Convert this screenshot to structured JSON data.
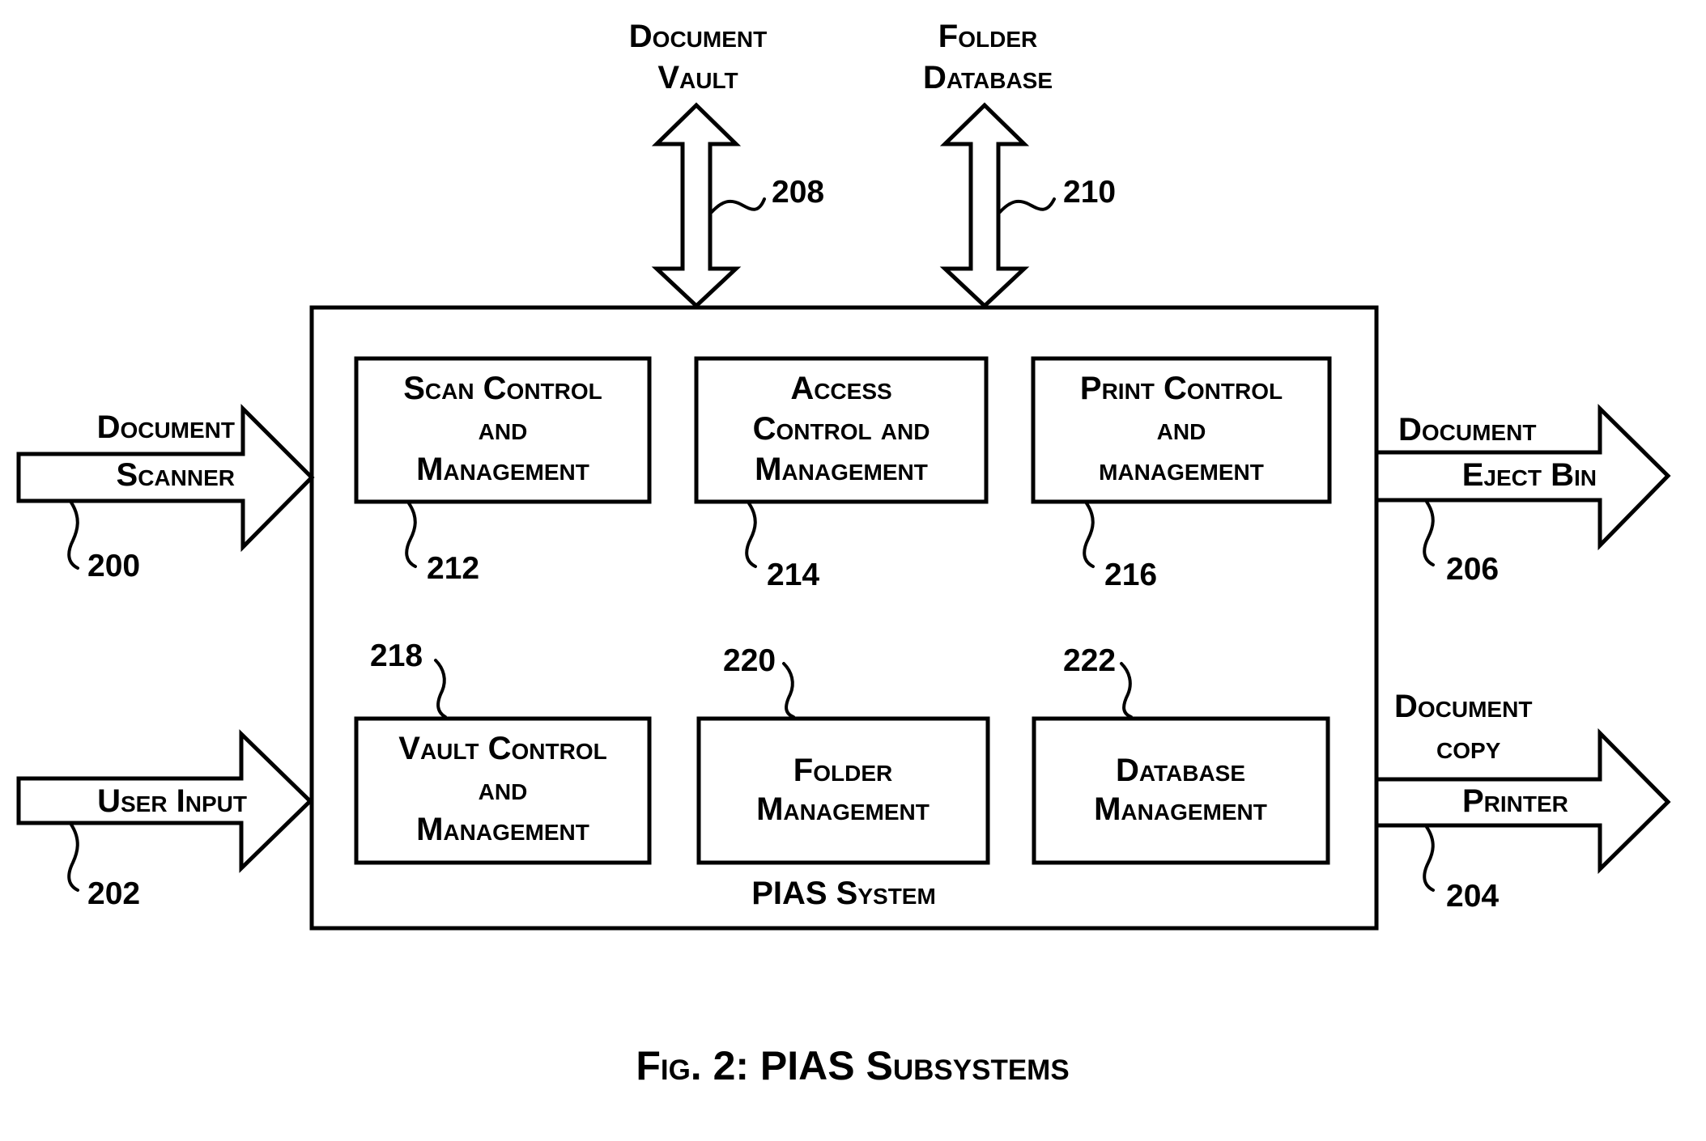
{
  "figure": {
    "caption": "Fig. 2: PIAS Subsystems",
    "system_label": "PIAS System"
  },
  "external": {
    "document_vault": {
      "lines": [
        "Document",
        "Vault"
      ],
      "ref": "208",
      "direction": "bidirectional"
    },
    "folder_database": {
      "lines": [
        "Folder",
        "Database"
      ],
      "ref": "210",
      "direction": "bidirectional"
    },
    "document_scanner": {
      "lines": [
        "Document",
        "Scanner"
      ],
      "ref": "200",
      "direction": "input"
    },
    "user_input": {
      "lines": [
        "User Input"
      ],
      "ref": "202",
      "direction": "input"
    },
    "document_eject_bin": {
      "lines": [
        "Document",
        "Eject Bin"
      ],
      "ref": "206",
      "direction": "output"
    },
    "document_copy_printer": {
      "lines": [
        "Document",
        "copy",
        "Printer"
      ],
      "ref": "204",
      "direction": "output"
    }
  },
  "subsystems": [
    {
      "id": "scan",
      "lines": [
        "Scan Control",
        "and",
        "Management"
      ],
      "ref": "212"
    },
    {
      "id": "access",
      "lines": [
        "Access",
        "Control and",
        "Management"
      ],
      "ref": "214"
    },
    {
      "id": "print",
      "lines": [
        "Print Control",
        "and",
        "management"
      ],
      "ref": "216"
    },
    {
      "id": "vault",
      "lines": [
        "Vault Control",
        "and",
        "Management"
      ],
      "ref": "218"
    },
    {
      "id": "folder",
      "lines": [
        "Folder",
        "Management"
      ],
      "ref": "220"
    },
    {
      "id": "database",
      "lines": [
        "Database",
        "Management"
      ],
      "ref": "222"
    }
  ],
  "colors": {
    "ink": "#000000",
    "paper": "#ffffff"
  }
}
